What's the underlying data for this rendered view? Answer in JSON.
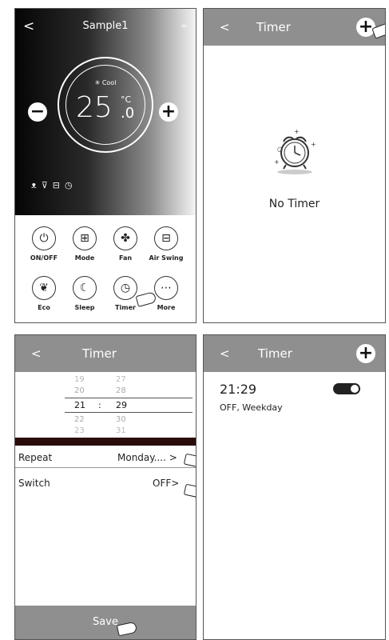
{
  "ac": {
    "back": "<",
    "title": "Sample1",
    "more_dots": "∞",
    "mode": "Cool",
    "temp_int": "25",
    "temp_unit": "°C",
    "temp_dec": ".0",
    "minus": "−",
    "plus": "+",
    "controls": [
      "ON/OFF",
      "Mode",
      "Fan",
      "Air Swing",
      "Eco",
      "Sleep",
      "Timer",
      "More"
    ]
  },
  "timer_empty": {
    "back": "<",
    "title": "Timer",
    "plus": "+",
    "empty_text": "No Timer"
  },
  "timer_edit": {
    "back": "<",
    "title": "Timer",
    "picker": [
      {
        "h": "19",
        "m": "27"
      },
      {
        "h": "20",
        "m": "28"
      },
      {
        "h": "21",
        "m": "29"
      },
      {
        "h": "22",
        "m": "30"
      },
      {
        "h": "23",
        "m": "31"
      }
    ],
    "separator": ":",
    "repeat_label": "Repeat",
    "repeat_value": "Monday.... >",
    "switch_label": "Switch",
    "switch_value": "OFF>",
    "save": "Save"
  },
  "timer_list": {
    "back": "<",
    "title": "Timer",
    "plus": "+",
    "time": "21:29",
    "detail": "OFF, Weekday",
    "enabled": true
  }
}
